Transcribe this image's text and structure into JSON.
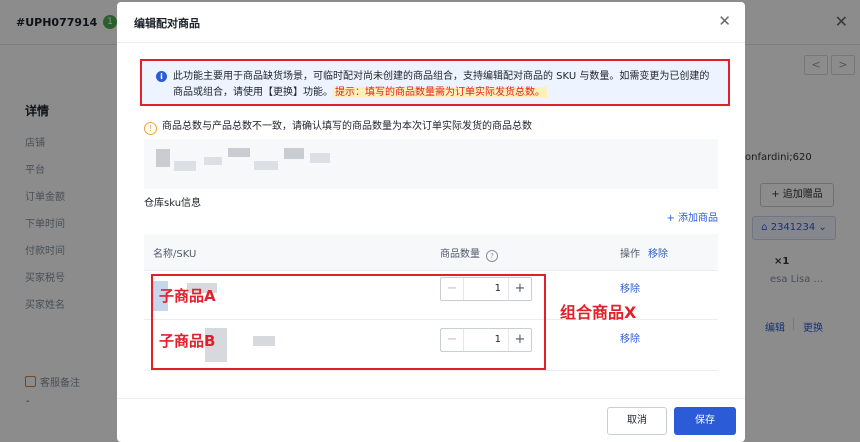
{
  "background": {
    "order_id": "#UPH077914",
    "badge": "1",
    "detail_title": "详情",
    "fields": [
      "店铺",
      "平台",
      "订单金额",
      "下单时间",
      "付款时间",
      "买家税号",
      "买家姓名"
    ],
    "remark_label": "客服备注",
    "remark_value": "-",
    "right_text": "onfardini;620",
    "add_gift": "+ 追加赠品",
    "warehouse": "2341234",
    "qty_text": "×1",
    "product_text": "esa Lisa ...",
    "edit": "编辑",
    "replace": "更换"
  },
  "modal": {
    "title": "编辑配对商品",
    "info_text": "此功能主要用于商品缺货场景，可临时配对尚未创建的商品组合，支持编辑配对商品的 SKU 与数量。如需变更为已创建的商品或组合，请使用【更换】功能。",
    "info_tip": "提示：填写的商品数量需为订单实际发货总数。",
    "warning": "商品总数与产品总数不一致，请确认填写的商品数量为本次订单实际发货的商品总数",
    "sku_section_label": "仓库sku信息",
    "add_product": "+ 添加商品",
    "table": {
      "col_name": "名称/SKU",
      "col_qty": "商品数量",
      "col_action": "操作",
      "header_remove": "移除"
    },
    "rows": [
      {
        "label": "子商品A",
        "quantity": "1",
        "remove": "移除"
      },
      {
        "label": "子商品B",
        "quantity": "1",
        "remove": "移除"
      }
    ],
    "group_label": "组合商品X",
    "cancel": "取消",
    "save": "保存"
  }
}
